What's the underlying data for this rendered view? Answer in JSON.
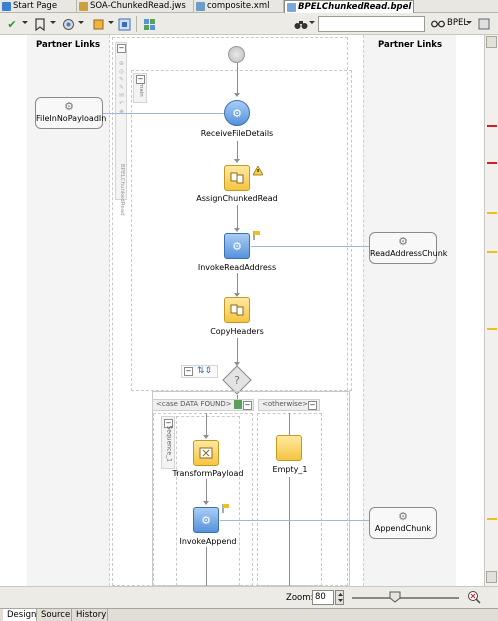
{
  "tabs": [
    {
      "label": "Start Page"
    },
    {
      "label": "SOA-ChunkedRead.jws"
    },
    {
      "label": "composite.xml"
    },
    {
      "label": "BPELChunkedRead.bpel"
    }
  ],
  "toolbar": {
    "bpel_menu": "BPEL"
  },
  "lanes": {
    "left_title": "Partner Links",
    "right_title": "Partner Links"
  },
  "scope_labels": {
    "main": "main",
    "process": "BPELChunkedRead",
    "case": "<case DATA FOUND>",
    "otherwise": "<otherwise>",
    "sequence": "Sequence_1"
  },
  "partners": {
    "left": "FileInNoPayloadIn",
    "read": "ReadAddressChunk",
    "append": "AppendChunk"
  },
  "activities": {
    "receive": "ReceiveFileDetails",
    "assign": "AssignChunkedRead",
    "invoke_read": "InvokeReadAddress",
    "copy": "CopyHeaders",
    "transform": "TransformPayload",
    "invoke_append": "InvokeAppend",
    "empty": "Empty_1"
  },
  "zoom": {
    "label": "Zoom:",
    "value": "80"
  },
  "bottom_tabs": [
    {
      "label": "Design"
    },
    {
      "label": "Source"
    },
    {
      "label": "History"
    }
  ],
  "colors": {
    "error_marker": "#cc2222",
    "warning_marker": "#e8c020",
    "yellow_activity": "#f5c542",
    "blue_activity": "#5592dc"
  }
}
